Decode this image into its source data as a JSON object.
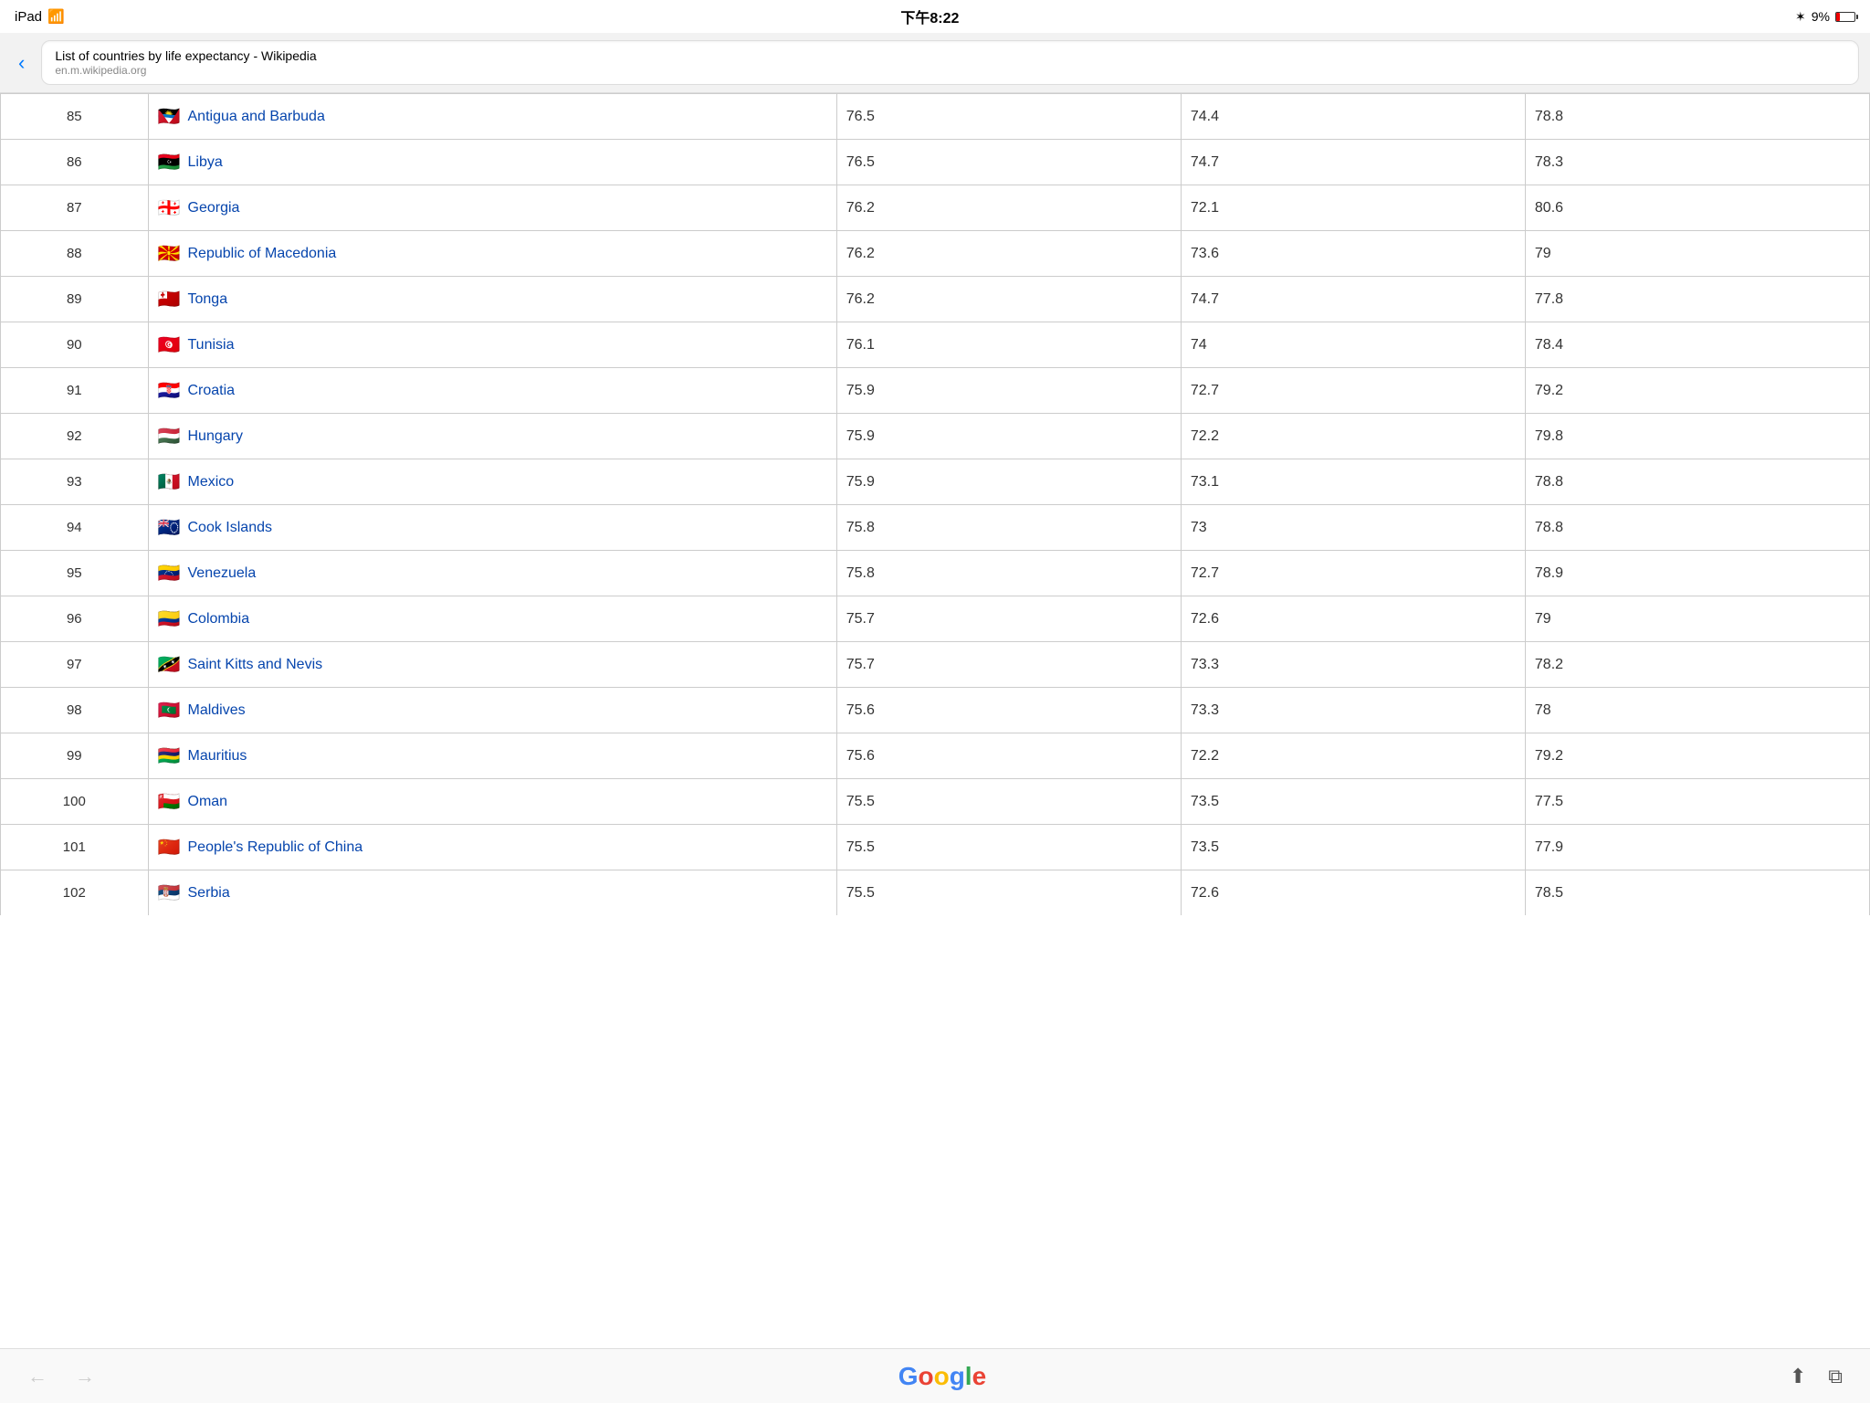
{
  "statusBar": {
    "device": "iPad",
    "wifi": "wifi",
    "time": "下午8:22",
    "bluetooth": "✶",
    "battery_pct": "9%"
  },
  "browserBar": {
    "title": "List of countries by life expectancy - Wikipedia",
    "domain": "en.m.wikipedia.org"
  },
  "table": {
    "rows": [
      {
        "rank": 85,
        "country": "Antigua and Barbuda",
        "flag": "🇦🇬",
        "overall": "76.5",
        "male": "74.4",
        "female": "78.8",
        "multiline": false
      },
      {
        "rank": 86,
        "country": "Libya",
        "flag": "🇱🇾",
        "overall": "76.5",
        "male": "74.7",
        "female": "78.3",
        "multiline": false
      },
      {
        "rank": 87,
        "country": "Georgia",
        "flag": "🇬🇪",
        "overall": "76.2",
        "male": "72.1",
        "female": "80.6",
        "multiline": false
      },
      {
        "rank": 88,
        "country": "Republic of Macedonia",
        "flag": "🇲🇰",
        "overall": "76.2",
        "male": "73.6",
        "female": "79",
        "multiline": false
      },
      {
        "rank": 89,
        "country": "Tonga",
        "flag": "🇹🇴",
        "overall": "76.2",
        "male": "74.7",
        "female": "77.8",
        "multiline": false
      },
      {
        "rank": 90,
        "country": "Tunisia",
        "flag": "🇹🇳",
        "overall": "76.1",
        "male": "74",
        "female": "78.4",
        "multiline": false
      },
      {
        "rank": 91,
        "country": "Croatia",
        "flag": "🇭🇷",
        "overall": "75.9",
        "male": "72.7",
        "female": "79.2",
        "multiline": false
      },
      {
        "rank": 92,
        "country": "Hungary",
        "flag": "🇭🇺",
        "overall": "75.9",
        "male": "72.2",
        "female": "79.8",
        "multiline": false
      },
      {
        "rank": 93,
        "country": "Mexico",
        "flag": "🇲🇽",
        "overall": "75.9",
        "male": "73.1",
        "female": "78.8",
        "multiline": false
      },
      {
        "rank": 94,
        "country": "Cook Islands",
        "flag": "🇨🇰",
        "overall": "75.8",
        "male": "73",
        "female": "78.8",
        "multiline": false
      },
      {
        "rank": 95,
        "country": "Venezuela",
        "flag": "🇻🇪",
        "overall": "75.8",
        "male": "72.7",
        "female": "78.9",
        "multiline": false
      },
      {
        "rank": 96,
        "country": "Colombia",
        "flag": "🇨🇴",
        "overall": "75.7",
        "male": "72.6",
        "female": "79",
        "multiline": false
      },
      {
        "rank": 97,
        "country": "Saint Kitts and Nevis",
        "flag": "🇰🇳",
        "overall": "75.7",
        "male": "73.3",
        "female": "78.2",
        "multiline": false
      },
      {
        "rank": 98,
        "country": "Maldives",
        "flag": "🇲🇻",
        "overall": "75.6",
        "male": "73.3",
        "female": "78",
        "multiline": false
      },
      {
        "rank": 99,
        "country": "Mauritius",
        "flag": "🇲🇺",
        "overall": "75.6",
        "male": "72.2",
        "female": "79.2",
        "multiline": false
      },
      {
        "rank": 100,
        "country": "Oman",
        "flag": "🇴🇲",
        "overall": "75.5",
        "male": "73.5",
        "female": "77.5",
        "multiline": false
      },
      {
        "rank": 101,
        "country": "People's Republic of China",
        "flag": "🇨🇳",
        "overall": "75.5",
        "male": "73.5",
        "female": "77.9",
        "multiline": true
      },
      {
        "rank": 102,
        "country": "Serbia",
        "flag": "🇷🇸",
        "overall": "75.5",
        "male": "72.6",
        "female": "78.5",
        "multiline": false,
        "partial": true
      }
    ]
  },
  "bottomBar": {
    "back": "←",
    "forward": "→",
    "share": "⬆",
    "tabs": "⧉"
  }
}
